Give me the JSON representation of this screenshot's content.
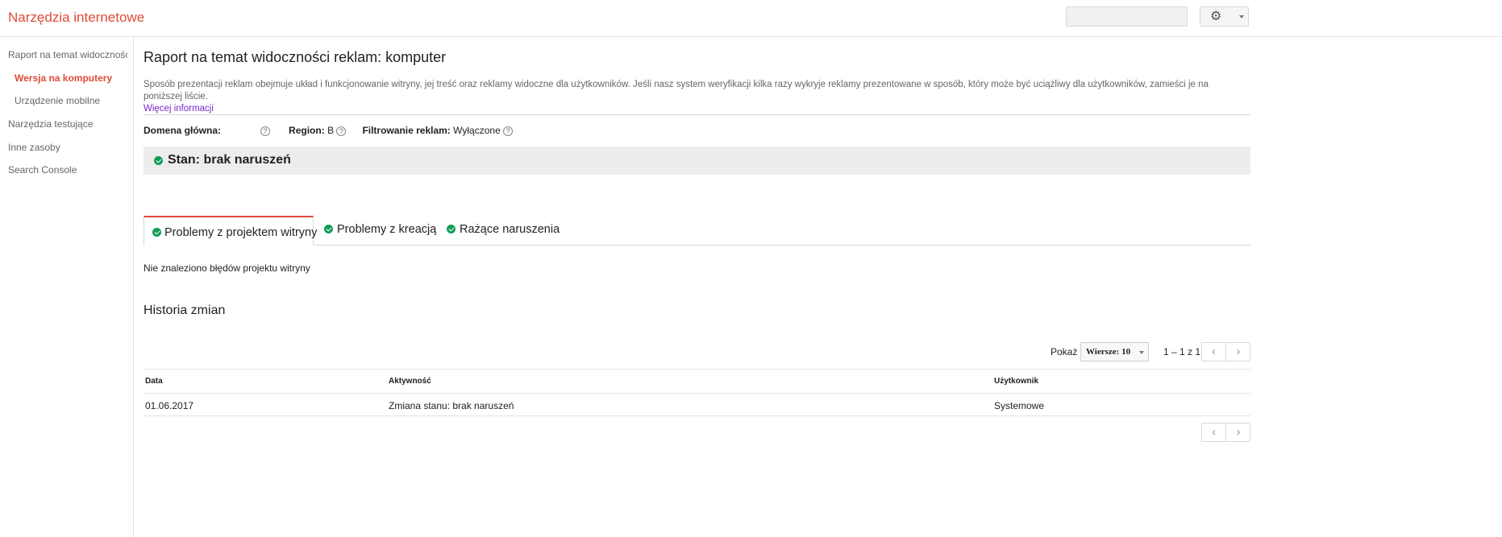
{
  "header": {
    "title": "Narzędzia internetowe",
    "search_placeholder": "",
    "settings_icon": "gear-icon"
  },
  "sidebar": {
    "items": [
      {
        "label": "Raport na temat widoczności r"
      },
      {
        "label": "Wersja na komputery",
        "active": true
      },
      {
        "label": "Urządzenie mobilne"
      },
      {
        "label": "Narzędzia testujące"
      },
      {
        "label": "Inne zasoby"
      },
      {
        "label": "Search Console"
      }
    ]
  },
  "main": {
    "title": "Raport na temat widoczności reklam: komputer",
    "description": "Sposób prezentacji reklam obejmuje układ i funkcjonowanie witryny, jej treść oraz reklamy widoczne dla użytkowników. Jeśli nasz system weryfikacji kilka razy wykryje reklamy prezentowane w sposób, który może być uciążliwy dla użytkowników, zamieści je na poniższej liście.",
    "more_info_link": "Więcej informacji",
    "domain_label": "Domena główna:",
    "domain_value": "",
    "region_label": "Region:",
    "region_value": "B",
    "filtering_label": "Filtrowanie reklam:",
    "filtering_value": "Wyłączone",
    "help_glyph": "?",
    "status": "Stan: brak naruszeń",
    "tabs": [
      {
        "label": "Problemy z projektem witryny",
        "active": true
      },
      {
        "label": "Problemy z kreacją"
      },
      {
        "label": "Rażące naruszenia"
      }
    ],
    "tab_message": "Nie znaleziono błędów projektu witryny",
    "history_title": "Historia zmian",
    "pagination": {
      "show_label": "Pokaż",
      "rows_select": "Wiersze: 10",
      "range": "1 – 1 z 1"
    },
    "table": {
      "headers": [
        "Data",
        "Aktywność",
        "Użytkownik"
      ],
      "rows": [
        [
          "01.06.2017",
          "Zmiana stanu: brak naruszeń",
          "Systemowe"
        ]
      ]
    }
  },
  "colors": {
    "accent": "#dd4b39",
    "success": "#0f9d58",
    "link": "#7d26cd",
    "status_bg": "#ededed"
  }
}
